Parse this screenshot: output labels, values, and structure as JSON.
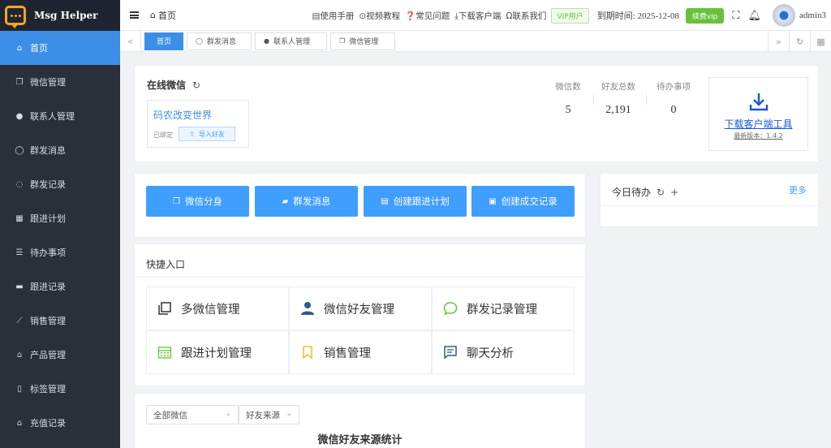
{
  "app": {
    "name": "Msg Helper"
  },
  "sidebar": {
    "items": [
      {
        "label": "首页",
        "icon": "home-icon",
        "active": true
      },
      {
        "label": "微信管理",
        "icon": "copy-icon"
      },
      {
        "label": "联系人管理",
        "icon": "user-icon"
      },
      {
        "label": "群发消息",
        "icon": "chat-bubble-icon"
      },
      {
        "label": "群发记录",
        "icon": "chat-dots-icon"
      },
      {
        "label": "跟进计划",
        "icon": "calendar-icon"
      },
      {
        "label": "待办事项",
        "icon": "list-icon"
      },
      {
        "label": "跟进记录",
        "icon": "briefcase-icon"
      },
      {
        "label": "销售管理",
        "icon": "chart-line-icon"
      },
      {
        "label": "产品管理",
        "icon": "bank-icon"
      },
      {
        "label": "标签管理",
        "icon": "bookmark-icon"
      },
      {
        "label": "充值记录",
        "icon": "bank-icon"
      }
    ]
  },
  "header": {
    "breadcrumb": "首页",
    "links": [
      "使用手册",
      "视频教程",
      "常见问题",
      "下载客户端",
      "联系我们"
    ],
    "vip_badge": "VIP用户",
    "expire_text": "到期时间: 2025-12-08",
    "renew_label": "续费vip",
    "username": "admin3"
  },
  "tabs": [
    {
      "label": "首页",
      "active": true
    },
    {
      "label": "群发消息",
      "icon": "chat-bubble-icon"
    },
    {
      "label": "联系人管理",
      "icon": "user-icon"
    },
    {
      "label": "微信管理",
      "icon": "copy-icon"
    }
  ],
  "online": {
    "title": "在线微信",
    "account_name": "码农改变世界",
    "bound_label": "已绑定",
    "import_label": "导入好友",
    "stats": [
      {
        "label": "微信数",
        "value": "5"
      },
      {
        "label": "好友总数",
        "value": "2,191"
      },
      {
        "label": "待办事项",
        "value": "0"
      }
    ],
    "download_label": "下载客户端工具",
    "version_label": "最新版本：1.4.2"
  },
  "actions": [
    {
      "label": "微信分身",
      "icon": "copy-icon"
    },
    {
      "label": "群发消息",
      "icon": "message-icon"
    },
    {
      "label": "创建跟进计划",
      "icon": "document-icon"
    },
    {
      "label": "创建成交记录",
      "icon": "receipt-icon"
    }
  ],
  "todo": {
    "title": "今日待办",
    "more_label": "更多"
  },
  "quick": {
    "title": "快捷入口",
    "items": [
      {
        "label": "多微信管理",
        "icon": "copy-icon",
        "color": "#333333"
      },
      {
        "label": "微信好友管理",
        "icon": "user-icon",
        "color": "#2f5b8c"
      },
      {
        "label": "群发记录管理",
        "icon": "chat-bubble-icon",
        "color": "#67c23a"
      },
      {
        "label": "跟进计划管理",
        "icon": "calendar-icon",
        "color": "#67c23a"
      },
      {
        "label": "销售管理",
        "icon": "bookmark-icon",
        "color": "#e6c422"
      },
      {
        "label": "聊天分析",
        "icon": "message-icon",
        "color": "#2f5b8c"
      }
    ]
  },
  "source_stats": {
    "select_wechat": "全部微信",
    "select_source": "好友来源",
    "chart_title": "微信好友来源统计"
  },
  "colors": {
    "accent": "#409eff",
    "sidebar_bg": "#2b2f3a",
    "active_menu": "#3c8ee6",
    "vip_green": "#67c23a"
  }
}
